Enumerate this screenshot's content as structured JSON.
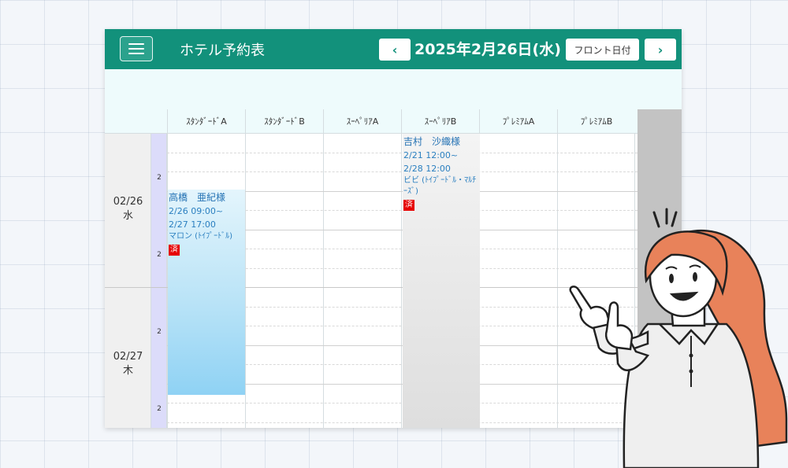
{
  "header": {
    "title": "ホテル予約表",
    "prev_label": "‹",
    "next_label": "›",
    "date": "2025年2月26日(水)",
    "front_button": "フロント日付"
  },
  "rooms": [
    "ｽﾀﾝﾀﾞｰﾄﾞA",
    "ｽﾀﾝﾀﾞｰﾄﾞB",
    "ｽｰﾍﾟﾘｱA",
    "ｽｰﾍﾟﾘｱB",
    "ﾌﾟﾚﾐｱﾑA",
    "ﾌﾟﾚﾐｱﾑB"
  ],
  "days": [
    {
      "date": "02/26",
      "weekday": "水"
    },
    {
      "date": "02/27",
      "weekday": "木"
    }
  ],
  "slots": [
    "2",
    "2",
    "2",
    "2"
  ],
  "bookings": [
    {
      "room": "ｽﾀﾝﾀﾞｰﾄﾞA",
      "name": "高橋　亜紀様",
      "checkin": "2/26 09:00~",
      "checkout": "2/27 17:00",
      "pet": "マロン (ﾄｲﾌﾟｰﾄﾞﾙ)",
      "status": "済"
    },
    {
      "room": "ｽｰﾍﾟﾘｱB",
      "name": "吉村　沙織様",
      "checkin": "2/21 12:00~",
      "checkout": "2/28 12:00",
      "pet": "ビビ (ﾄｲﾌﾟｰﾄﾞﾙ・ﾏﾙﾁｰｽﾞ)",
      "status": "済"
    }
  ],
  "colors": {
    "header": "#12917b",
    "subbar": "#eefbfc",
    "slot_column": "#dcdcfa",
    "booking_blue": "#8fd2f4",
    "booking_gray": "#dedede",
    "badge": "#e60000"
  },
  "icons": [
    "menu-icon",
    "chevron-left-icon",
    "chevron-right-icon"
  ]
}
